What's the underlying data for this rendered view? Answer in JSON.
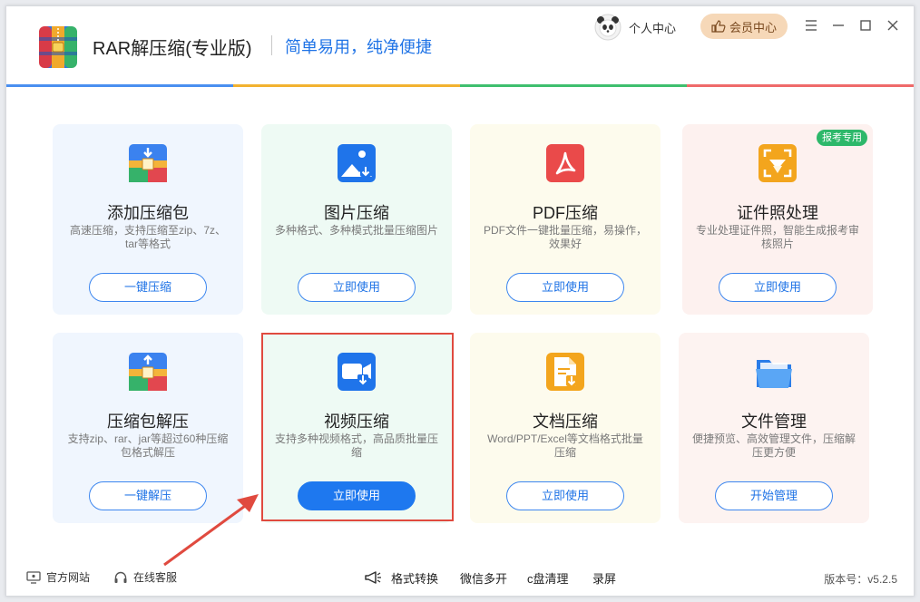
{
  "app": {
    "title": "RAR解压缩(专业版)",
    "slogan": "简单易用，纯净便捷",
    "user_center": "个人中心",
    "vip_center": "会员中心"
  },
  "colors": {
    "accent_blue": "#1e78ef",
    "bar_blue": "#4a8ff0",
    "bar_yellow": "#f2b230",
    "bar_green": "#3fbf6e",
    "bar_red": "#ef6a6a",
    "highlight": "#e04a3f"
  },
  "cards": [
    {
      "title": "添加压缩包",
      "desc": "高速压缩，支持压缩至zip、7z、tar等格式",
      "button": "一键压缩",
      "icon": "archive-add-icon",
      "bg": "#f0f6fe"
    },
    {
      "title": "图片压缩",
      "desc": "多种格式、多种模式批量压缩图片",
      "button": "立即使用",
      "icon": "image-compress-icon",
      "bg": "#eefaf4"
    },
    {
      "title": "PDF压缩",
      "desc": "PDF文件一键批量压缩，易操作，效果好",
      "button": "立即使用",
      "icon": "pdf-icon",
      "bg": "#fdfbed"
    },
    {
      "title": "证件照处理",
      "desc": "专业处理证件照，智能生成报考审核照片",
      "button": "立即使用",
      "icon": "id-photo-icon",
      "bg": "#fdf1ef",
      "tag": "报考专用"
    },
    {
      "title": "压缩包解压",
      "desc": "支持zip、rar、jar等超过60种压缩包格式解压",
      "button": "一键解压",
      "icon": "archive-extract-icon",
      "bg": "#f0f6fe"
    },
    {
      "title": "视频压缩",
      "desc": "支持多种视频格式，高品质批量压缩",
      "button": "立即使用",
      "icon": "video-compress-icon",
      "bg": "#eefaf4"
    },
    {
      "title": "文档压缩",
      "desc": "Word/PPT/Excel等文档格式批量压缩",
      "button": "立即使用",
      "icon": "document-compress-icon",
      "bg": "#fdfbed"
    },
    {
      "title": "文件管理",
      "desc": "便捷预览、高效管理文件，压缩解压更方便",
      "button": "开始管理",
      "icon": "folder-icon",
      "bg": "#fdf3f1"
    }
  ],
  "footer": {
    "website": "官方网站",
    "support": "在线客服",
    "tools": [
      "格式转换",
      "微信多开",
      "c盘清理",
      "录屏"
    ],
    "version": "版本号：v5.2.5"
  }
}
